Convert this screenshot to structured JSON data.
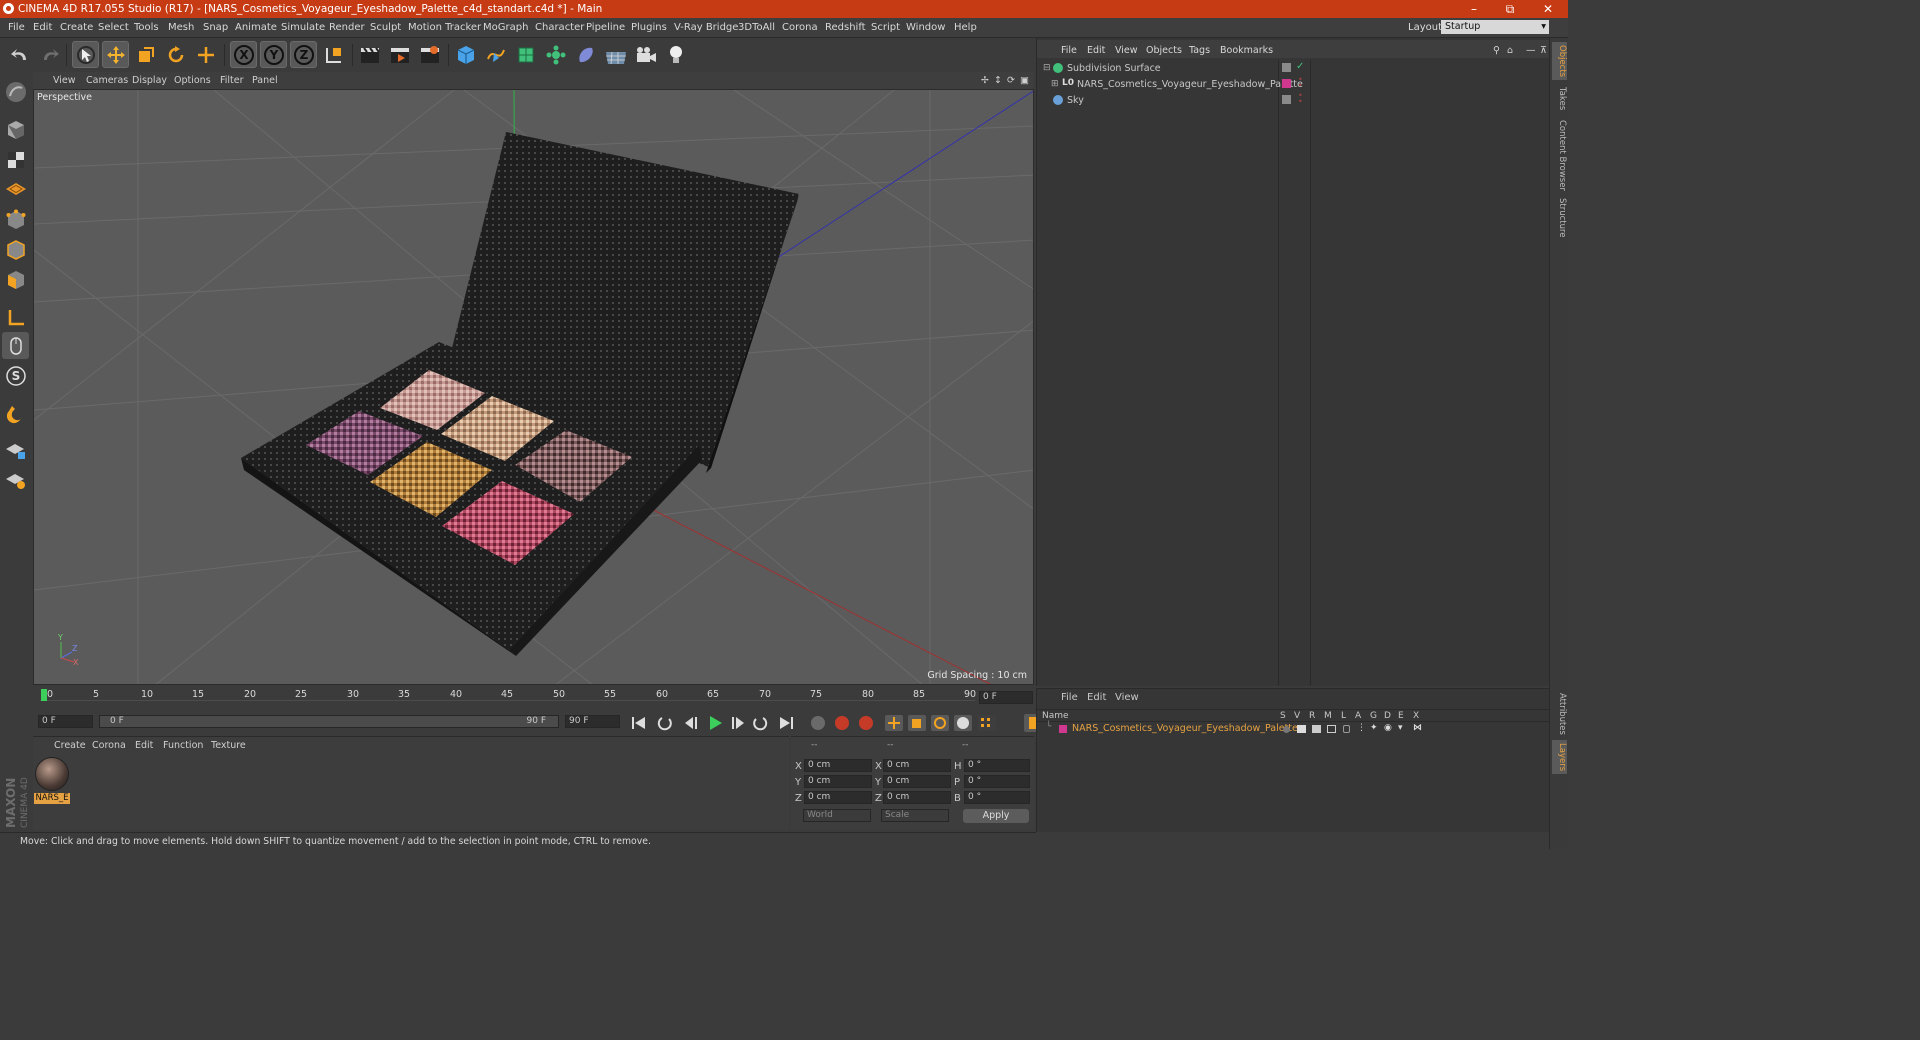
{
  "window": {
    "title": "CINEMA 4D R17.055 Studio (R17) - [NARS_Cosmetics_Voyageur_Eyeshadow_Palette_c4d_standart.c4d *] - Main",
    "minimize_icon": "minimize-icon",
    "restore_icon": "restore-icon",
    "close_icon": "close-icon"
  },
  "menubar": {
    "items": [
      "File",
      "Edit",
      "Create",
      "Select",
      "Tools",
      "Mesh",
      "Snap",
      "Animate",
      "Simulate",
      "Render",
      "Sculpt",
      "Motion Tracker",
      "MoGraph",
      "Character",
      "Pipeline",
      "Plugins",
      "V-Ray Bridge",
      "3DToAll",
      "Corona",
      "Redshift",
      "Script",
      "Window",
      "Help"
    ],
    "layout_label": "Layout:",
    "layout_value": "Startup"
  },
  "viewport": {
    "menu": [
      "View",
      "Cameras",
      "Display",
      "Options",
      "Filter",
      "Panel"
    ],
    "label": "Perspective",
    "grid_spacing": "Grid Spacing : 10 cm",
    "axis_y": "Y",
    "axis_z": "Z",
    "axis_x": "X"
  },
  "timeline": {
    "ticks": [
      "0",
      "5",
      "10",
      "15",
      "20",
      "25",
      "30",
      "35",
      "40",
      "45",
      "50",
      "55",
      "60",
      "65",
      "70",
      "75",
      "80",
      "85",
      "90"
    ],
    "current_frame": "0 F",
    "start": "0 F",
    "range_start": "0 F",
    "range_end": "90 F",
    "end": "90 F",
    "current_fraction": 0
  },
  "material_panel": {
    "menu": [
      "Create",
      "Corona",
      "Edit",
      "Function",
      "Texture"
    ],
    "material_name": "NARS_E"
  },
  "coord_panel": {
    "headers": [
      "--",
      "--",
      "--"
    ],
    "rows": [
      {
        "a": "X",
        "a_val": "0 cm",
        "b": "X",
        "b_val": "0 cm",
        "c": "H",
        "c_val": "0 °"
      },
      {
        "a": "Y",
        "a_val": "0 cm",
        "b": "Y",
        "b_val": "0 cm",
        "c": "P",
        "c_val": "0 °"
      },
      {
        "a": "Z",
        "a_val": "0 cm",
        "b": "Z",
        "b_val": "0 cm",
        "c": "B",
        "c_val": "0 °"
      }
    ],
    "mode1": "World",
    "mode2": "Scale",
    "apply": "Apply"
  },
  "status": "Move: Click and drag to move elements. Hold down SHIFT to quantize movement / add to the selection in point mode, CTRL to remove.",
  "objects_panel": {
    "menu": [
      "File",
      "Edit",
      "View",
      "Objects",
      "Tags",
      "Bookmarks"
    ],
    "objects": [
      {
        "name": "Subdivision Surface",
        "icon": "subdivision-icon"
      },
      {
        "name": "NARS_Cosmetics_Voyageur_Eyeshadow_Palette",
        "icon": "null-object-icon"
      },
      {
        "name": "Sky",
        "icon": "sky-icon"
      }
    ]
  },
  "layers_panel": {
    "menu": [
      "File",
      "Edit",
      "View"
    ],
    "columns": [
      "Name",
      "S",
      "V",
      "R",
      "M",
      "L",
      "A",
      "G",
      "D",
      "E",
      "X"
    ],
    "layer_name": "NARS_Cosmetics_Voyageur_Eyeshadow_Palette"
  },
  "right_tabs": [
    "Objects",
    "Takes",
    "Content Browser",
    "Structure",
    "Attributes",
    "Layers"
  ],
  "colors": {
    "titlebar": "#c63b14",
    "accent_orange": "#e5a142",
    "layer_pink": "#d0388f"
  },
  "brand": "MAXON CINEMA 4D"
}
